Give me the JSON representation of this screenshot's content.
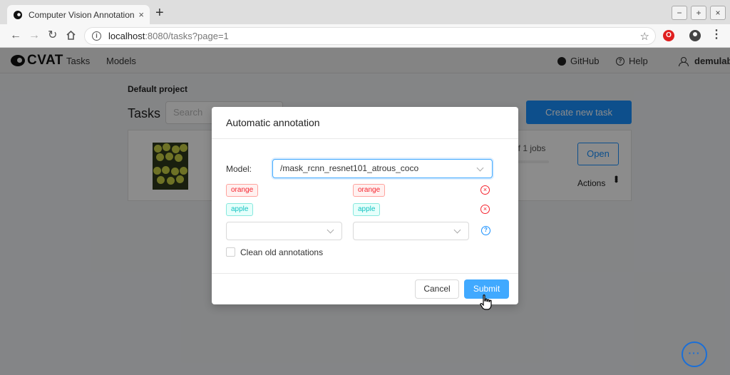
{
  "browser": {
    "tab_title": "Computer Vision Annotation To",
    "tab_close": "×",
    "new_tab": "+",
    "url_host": "localhost",
    "url_path": ":8080/tasks?page=1",
    "window_buttons": [
      "−",
      "+",
      "×"
    ]
  },
  "app": {
    "logo": "CVAT",
    "nav": {
      "tasks": "Tasks",
      "models": "Models"
    },
    "header_right": {
      "github": "GitHub",
      "help": "Help",
      "user": "demulab"
    }
  },
  "page": {
    "project": "Default project",
    "title": "Tasks",
    "search_placeholder": "Search",
    "create_button": "Create new task",
    "task": {
      "jobs_text": "of 1 jobs",
      "open_button": "Open",
      "actions_label": "Actions"
    }
  },
  "modal": {
    "title": "Automatic annotation",
    "model_label": "Model:",
    "model_value": "/mask_rcnn_resnet101_atrous_coco",
    "mappings": [
      {
        "model_label": "orange",
        "task_label": "orange",
        "color": "red"
      },
      {
        "model_label": "apple",
        "task_label": "apple",
        "color": "cyan"
      }
    ],
    "clean_label": "Clean old annotations",
    "cancel": "Cancel",
    "submit": "Submit"
  },
  "colors": {
    "primary": "#1890ff",
    "danger": "#f5222d",
    "cyan": "#13c2c2"
  }
}
